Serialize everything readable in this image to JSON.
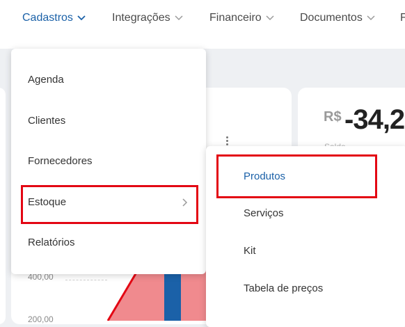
{
  "nav": {
    "items": [
      {
        "label": "Cadastros"
      },
      {
        "label": "Integrações"
      },
      {
        "label": "Financeiro"
      },
      {
        "label": "Documentos"
      },
      {
        "label": "F"
      }
    ]
  },
  "summary": {
    "currency": "R$",
    "amount": "-34,2",
    "subtext": "Saldo ..."
  },
  "chart": {
    "y_labels": [
      "400,00",
      "200,00"
    ]
  },
  "menu": {
    "items": [
      {
        "label": "Agenda"
      },
      {
        "label": "Clientes"
      },
      {
        "label": "Fornecedores"
      },
      {
        "label": "Estoque"
      },
      {
        "label": "Relatórios"
      }
    ]
  },
  "submenu": {
    "items": [
      {
        "label": "Produtos"
      },
      {
        "label": "Serviços"
      },
      {
        "label": "Kit"
      },
      {
        "label": "Tabela de preços"
      }
    ]
  },
  "right_hints": {
    "char1": "S",
    "char2": "F"
  },
  "colors": {
    "accent": "#1b61a8",
    "highlight": "#e30613",
    "chart_pink": "#f08a8e",
    "chart_blue": "#1b61a8"
  }
}
